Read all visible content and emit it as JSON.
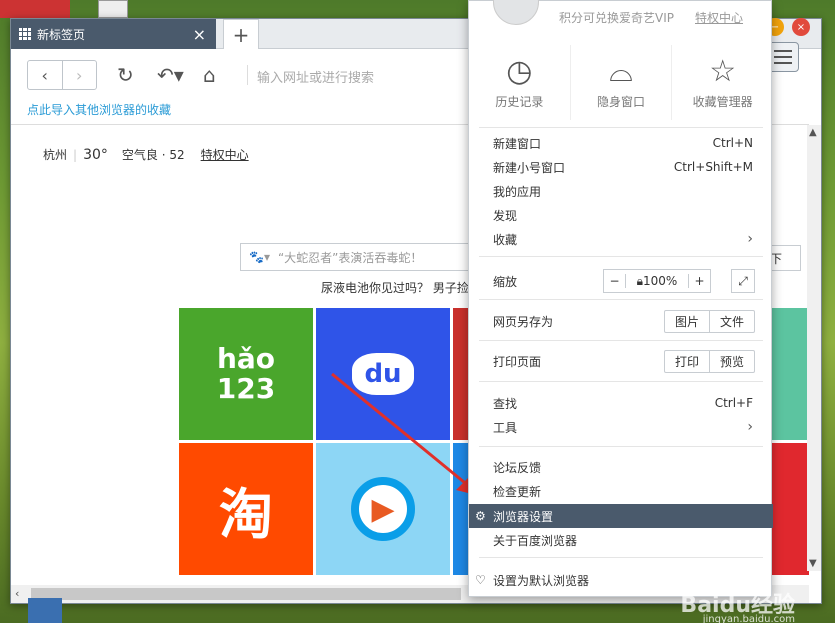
{
  "window": {
    "tab_title": "新标签页",
    "tab_close": "×",
    "new_tab": "+"
  },
  "toolbar": {
    "address_placeholder": "输入网址或进行搜索",
    "import_link": "点此导入其他浏览器的收藏"
  },
  "page": {
    "weather": {
      "city": "杭州",
      "temp": "30°",
      "air": "空气良 · 52",
      "privilege": "特权中心"
    },
    "search_placeholder": "“大蛇忍者”表演活吞毒蛇！",
    "search_button": "下",
    "news": "尿液电池你见过吗？ 男子捡",
    "tiles": [
      {
        "label": "hǎo\n123",
        "color": "#4aa62c"
      },
      {
        "label": "du",
        "color": "#2f54e8"
      },
      {
        "label": "",
        "color": "#c9302c"
      },
      {
        "label": "淘",
        "color": "#ff4a00"
      },
      {
        "label": "▶",
        "color": "#8dd6f5"
      },
      {
        "label": "",
        "color": "#1e88e5"
      }
    ]
  },
  "menu": {
    "vip_text": "积分可兑换爱奇艺VIP",
    "vip_link": "特权中心",
    "quick": [
      {
        "label": "历史记录",
        "icon": "clock-icon"
      },
      {
        "label": "隐身窗口",
        "icon": "mask-icon"
      },
      {
        "label": "收藏管理器",
        "icon": "star-icon"
      }
    ],
    "items": {
      "new_window": "新建窗口",
      "new_window_sc": "Ctrl+N",
      "new_small": "新建小号窗口",
      "new_small_sc": "Ctrl+Shift+M",
      "my_apps": "我的应用",
      "discover": "发现",
      "favorites": "收藏",
      "zoom": "缩放",
      "zoom_minus": "−",
      "zoom_value": "100%",
      "zoom_plus": "+",
      "save_as": "网页另存为",
      "save_img": "图片",
      "save_file": "文件",
      "print": "打印页面",
      "print_btn": "打印",
      "preview_btn": "预览",
      "find": "查找",
      "find_sc": "Ctrl+F",
      "tools": "工具",
      "feedback": "论坛反馈",
      "update": "检查更新",
      "settings": "浏览器设置",
      "about": "关于百度浏览器",
      "default": "设置为默认浏览器"
    }
  },
  "watermark": "Baidu经验",
  "watermark_url": "jingyan.baidu.com"
}
